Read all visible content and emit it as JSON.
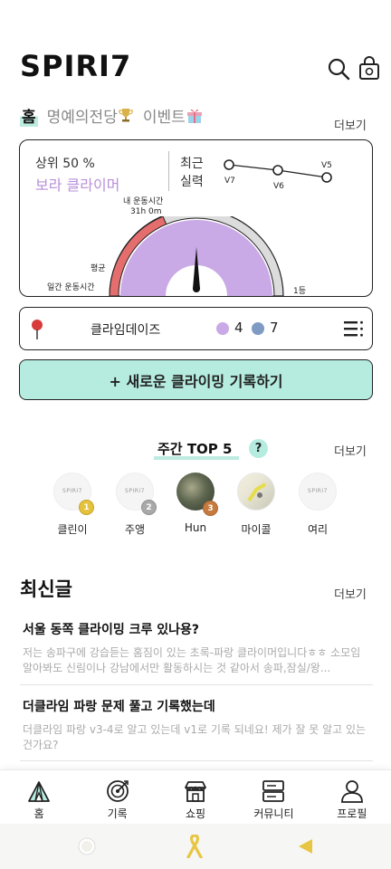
{
  "header": {
    "logo": "SPIRI7"
  },
  "tabs": [
    {
      "label": "홈",
      "icon": ""
    },
    {
      "label": "명예의전당",
      "icon": "trophy-icon"
    },
    {
      "label": "이벤트",
      "icon": "gift-icon"
    }
  ],
  "more_label": "더보기",
  "stats": {
    "rank_label": "상위 50 %",
    "rank_name": "보라 클라이머",
    "recent_label": "최근 실력",
    "recent_levels": [
      "V7",
      "V6",
      "V5"
    ],
    "my_time_label": "내 운동시간",
    "my_time_value": "31h 0m",
    "avg_label": "평균",
    "weekly_label": "일간 운동시간",
    "first_label": "1등",
    "gauge_colors": {
      "avg": "#e46d6d",
      "mine": "#c9a9e6",
      "rest": "#dcdcdc"
    }
  },
  "gym": {
    "name": "클라임데이즈",
    "purple_count": "4",
    "blue_count": "7",
    "purple_color": "#c9a9e6",
    "blue_color": "#7f9bc4"
  },
  "record_button": "+ 새로운 클라이밍 기록하기",
  "top5": {
    "title": "주간 TOP 5",
    "help": "?",
    "climbers": [
      {
        "name": "클린이",
        "medal": "1",
        "medal_color": "#e6c23a",
        "avatar_text": "SPIRI7"
      },
      {
        "name": "주앵",
        "medal": "2",
        "medal_color": "#a9a9a9",
        "avatar_text": "SPIRI7"
      },
      {
        "name": "Hun",
        "medal": "3",
        "medal_color": "#c77a3e",
        "avatar_text": ""
      },
      {
        "name": "마이콜",
        "medal": "",
        "medal_color": "",
        "avatar_text": ""
      },
      {
        "name": "여리",
        "medal": "",
        "medal_color": "",
        "avatar_text": "SPIRI7"
      }
    ]
  },
  "latest": {
    "title": "최신글",
    "posts": [
      {
        "title": "서울 동쪽 클라이밍 크루 있나용?",
        "body": "저는 송파구에 강습듣는 홈짐이 있는 초록-파랑 클라이머입니다ㅎㅎ 소모임 알아봐도 신림이나 강남에서만 활동하시는 것 같아서 송파,잠실/왕..."
      },
      {
        "title": "더클라임 파랑 문제 풀고 기록했는데",
        "body": "더클라임 파랑 v3-4로 알고 있는데 v1로 기록 되네요! 제가 잘 못 알고 있는건가요?"
      }
    ]
  },
  "bottom_nav": [
    {
      "label": "홈",
      "icon": "tent-icon"
    },
    {
      "label": "기록",
      "icon": "target-icon"
    },
    {
      "label": "쇼핑",
      "icon": "shop-icon"
    },
    {
      "label": "커뮤니티",
      "icon": "server-icon"
    },
    {
      "label": "프로필",
      "icon": "person-icon"
    }
  ],
  "accent": "#b5ecdf"
}
